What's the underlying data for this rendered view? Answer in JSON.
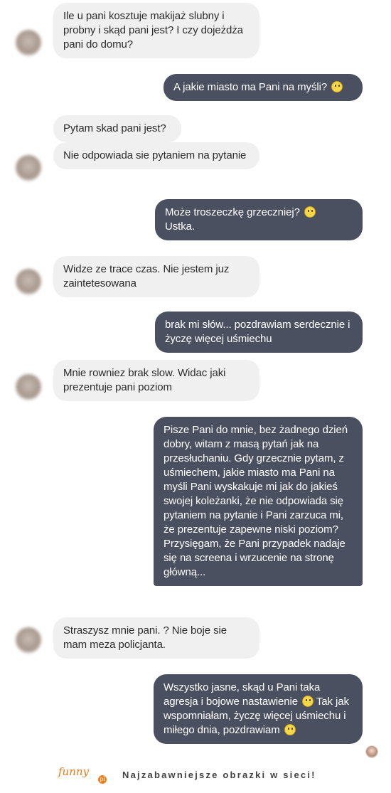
{
  "messages": [
    {
      "side": "in",
      "text": "Ile u pani kosztuje makijaż slubny i probny i skąd pani jest? I czy dojeżdża pani do domu?"
    },
    {
      "side": "out",
      "text": "A jakie miasto ma Pani na myśli?",
      "emoji": true
    },
    {
      "side": "in",
      "text": "Pytam skad pani jest?"
    },
    {
      "side": "in",
      "text": "Nie odpowiada sie pytaniem na pytanie"
    },
    {
      "side": "out",
      "text": "Może troszeczkę grzeczniej?",
      "emoji": true,
      "text2": "Ustka."
    },
    {
      "side": "in",
      "text": "Widze ze trace czas. Nie jestem juz zaintetesowana"
    },
    {
      "side": "out",
      "text": "brak mi słów... pozdrawiam serdecznie i życzę więcej uśmiechu"
    },
    {
      "side": "in",
      "text": "Mnie rowniez brak slow. Widac jaki prezentuje pani poziom"
    },
    {
      "side": "out",
      "text": "Pisze Pani do mnie, bez żadnego dzień dobry, witam z masą pytań jak na przesłuchaniu. Gdy grzecznie pytam, z uśmiechem, jakie miasto ma Pani na myśli Pani wyskakuje mi jak do jakieś swojej koleżanki, że nie odpowiada się pytaniem na pytanie i Pani zarzuca mi, że prezentuje zapewne niski poziom? Przysięgam, że Pani przypadek nadaje się na screena i wrzucenie na stronę główną..."
    },
    {
      "side": "in",
      "text": "Straszysz mnie pani. ? Nie boje sie mam meza policjanta."
    },
    {
      "side": "out",
      "text": "Wszystko jasne, skąd u Pani taka agresja i bojowe nastawienie",
      "emoji": true,
      "text2": "Tak jak wspomniałam, życzę więcej uśmiechu i miłego dnia, pozdrawiam",
      "emoji2": true
    }
  ],
  "footer": {
    "logo": "funny",
    "logo_badge": "pl",
    "tagline": "Najzabawniejsze obrazki w sieci!"
  },
  "colors": {
    "incoming_bubble": "#f1f0f0",
    "outgoing_bubble": "#4b5060",
    "outgoing_text": "#ffffff",
    "brand": "#ef7d1a"
  }
}
